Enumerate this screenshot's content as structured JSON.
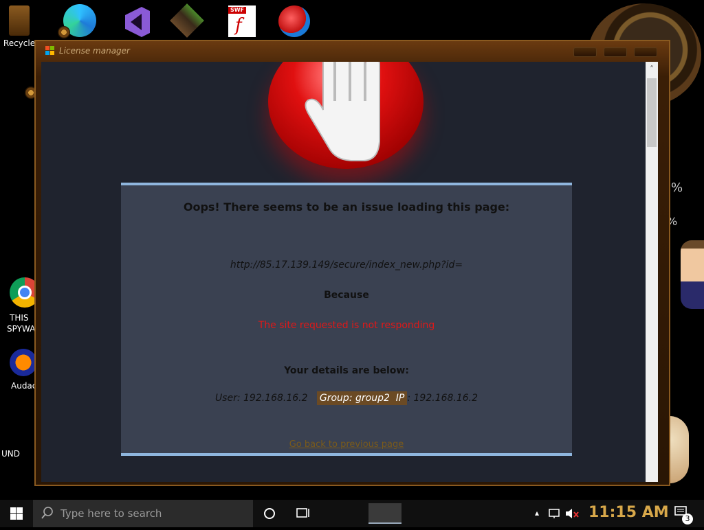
{
  "desktop": {
    "recycle_label": "Recycle",
    "left_labels": [
      "THIS",
      "SPYWA",
      "Audaci",
      "UND"
    ],
    "side_percent_1": "%",
    "side_percent_2": "%"
  },
  "window": {
    "title": "License manager"
  },
  "dialog": {
    "heading": "Oops! There seems to be an issue loading this page:",
    "url": "http://85.17.139.149/secure/index_new.php?id=",
    "because": "Because",
    "reason": "The site requested is not responding",
    "details_heading": "Your details are below:",
    "user_label": "User: 192.168.16.2",
    "group_label": "Group: group2",
    "ip_label": "IP",
    "ip_value": ": 192.168.16.2",
    "link": "Go back to previous page"
  },
  "taskbar": {
    "search_placeholder": "Type here to search",
    "time": "11:15 AM",
    "notification_count": "3"
  },
  "colors": {
    "dialog_bg": "#3a4151",
    "dialog_border": "#8fb6de",
    "reason": "#e01818",
    "clock": "#d8a84a"
  }
}
